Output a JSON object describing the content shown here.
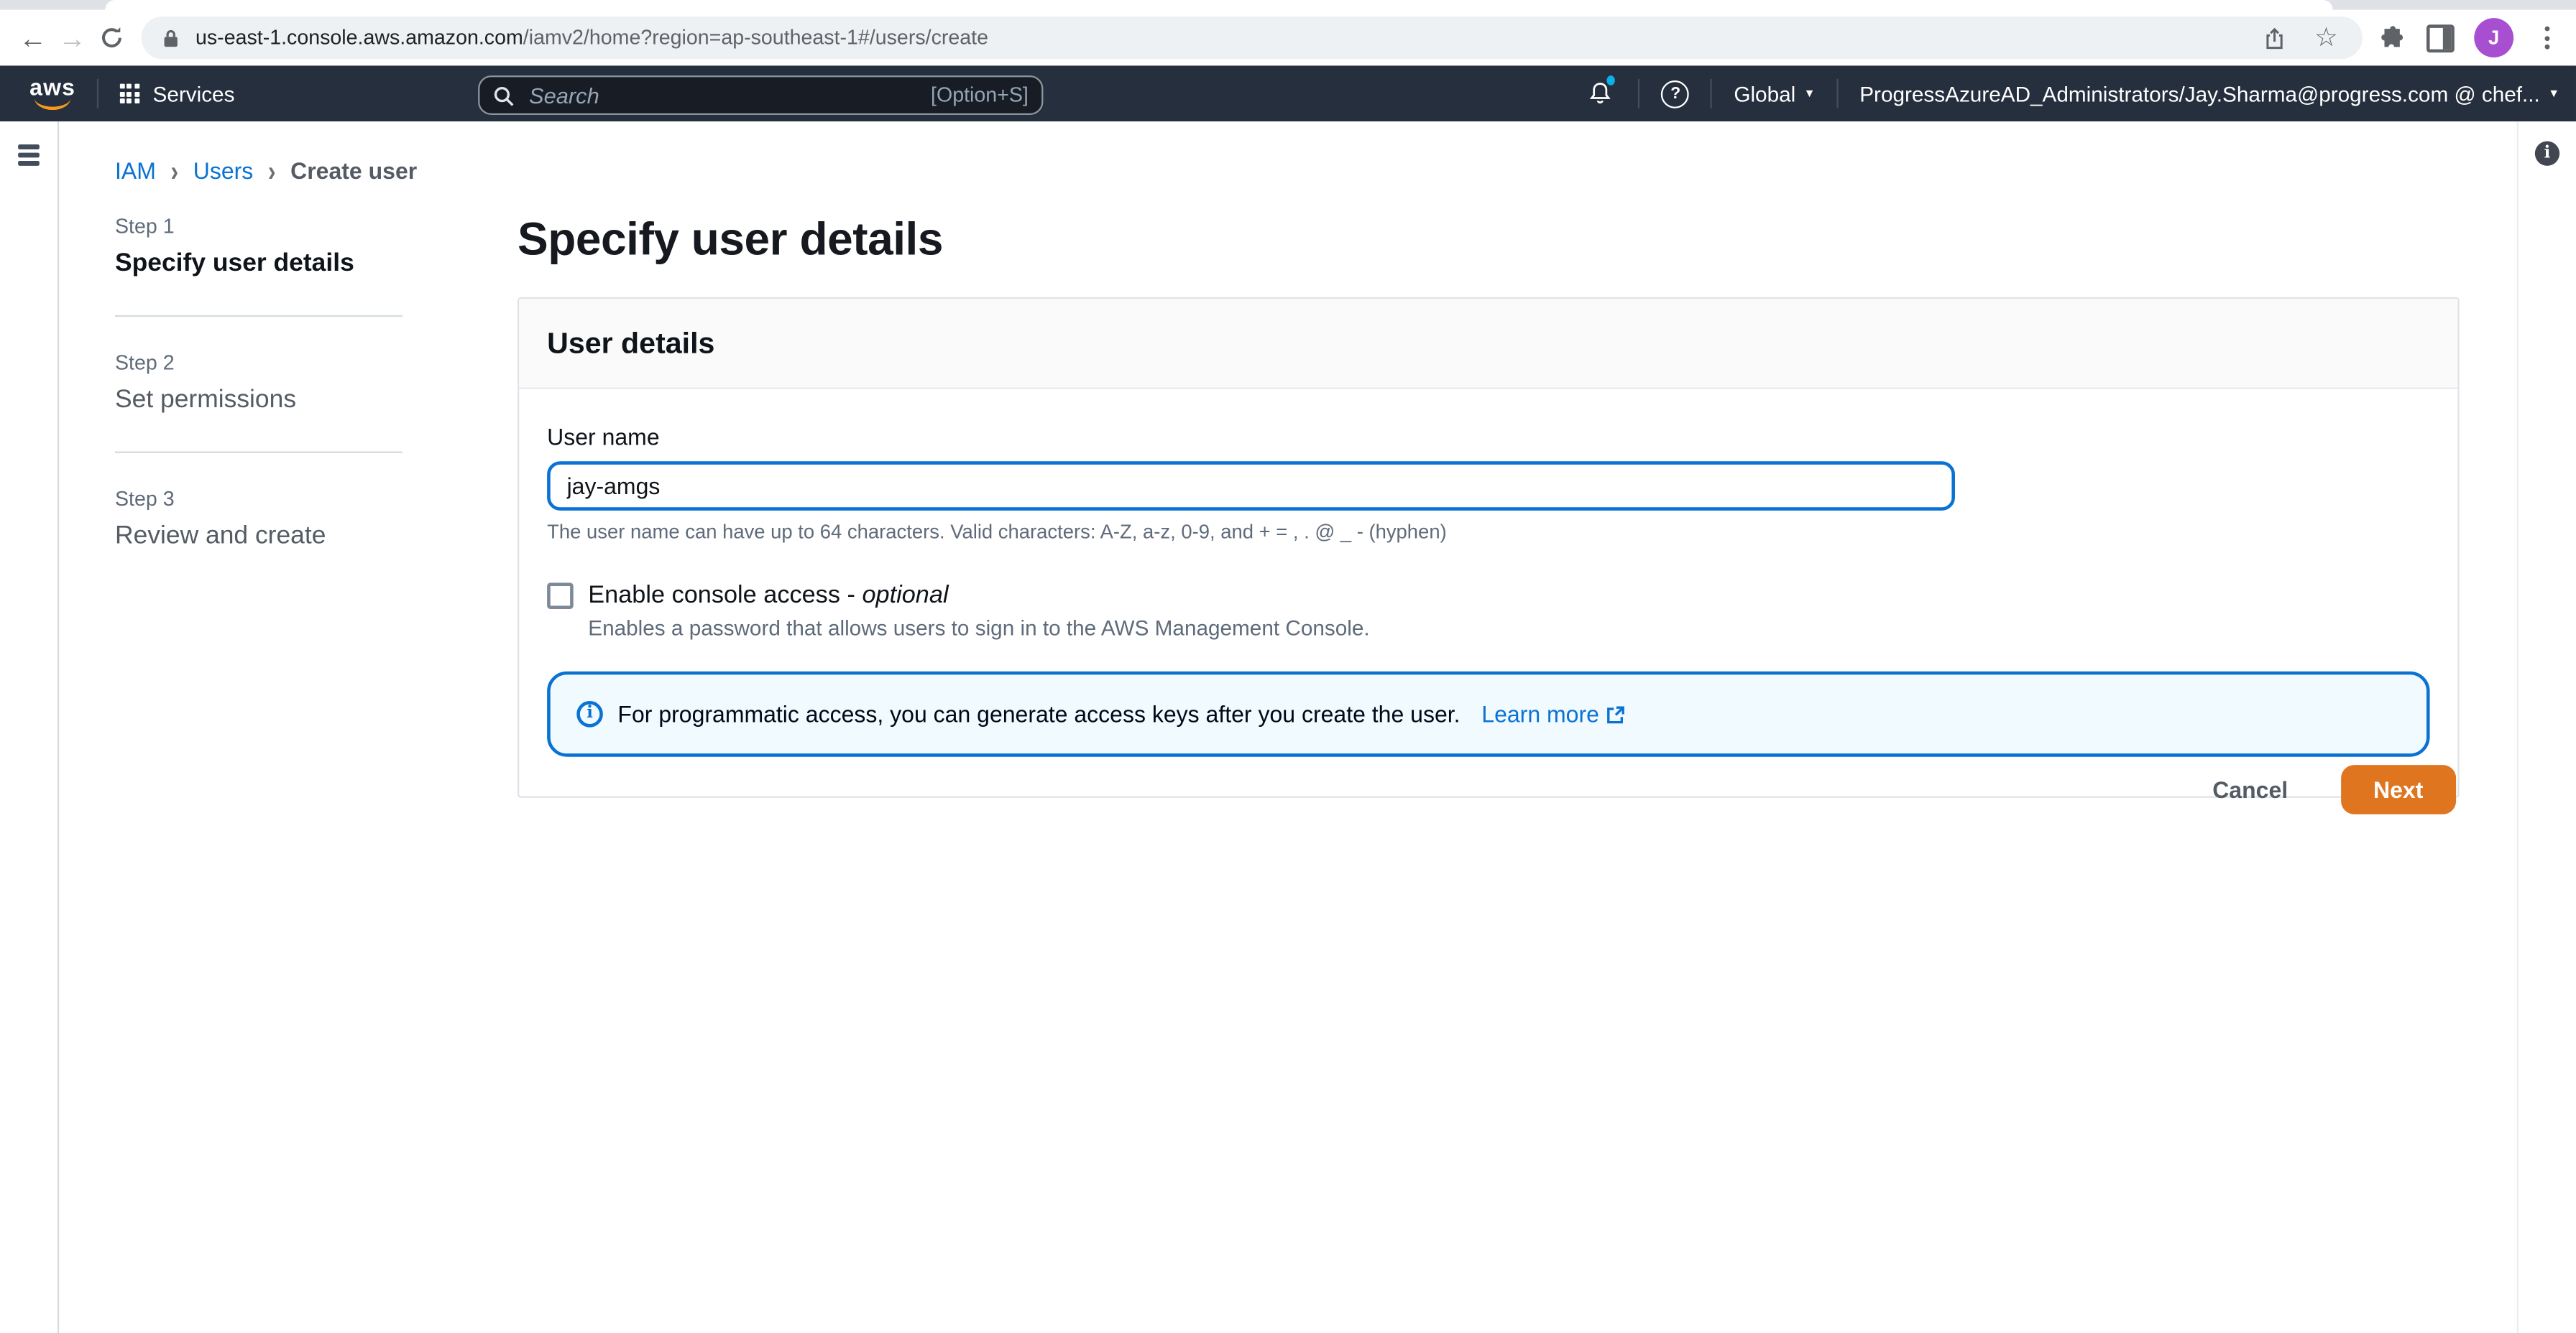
{
  "theme": {
    "nav_bg": "#252f3d",
    "accent_orange": "#e0751f",
    "link_blue": "#0972d3",
    "alert_bg": "#f1faff",
    "focus_border": "#0972d3",
    "avatar_purple": "#a84fd1",
    "notification_dot": "#0bb0e8",
    "aws_smile": "#f89820"
  },
  "browser": {
    "url_domain": "us-east-1.console.aws.amazon.com",
    "url_path": "/iamv2/home?region=ap-southeast-1#/users/create",
    "avatar_initial": "J"
  },
  "nav": {
    "logo": "aws",
    "services_label": "Services",
    "search_placeholder": "Search",
    "search_shortcut": "[Option+S]",
    "region_label": "Global",
    "account_label": "ProgressAzureAD_Administrators/Jay.Sharma@progress.com @ chef..."
  },
  "breadcrumb": {
    "items": [
      {
        "label": "IAM"
      },
      {
        "label": "Users"
      },
      {
        "label": "Create user"
      }
    ]
  },
  "steps": [
    {
      "step": "Step 1",
      "label": "Specify user details",
      "active": true
    },
    {
      "step": "Step 2",
      "label": "Set permissions",
      "active": false
    },
    {
      "step": "Step 3",
      "label": "Review and create",
      "active": false
    }
  ],
  "main": {
    "title": "Specify user details",
    "card": {
      "header": "User details",
      "username_label": "User name",
      "username_value": "jay-amgs",
      "username_help": "The user name can have up to 64 characters. Valid characters: A-Z, a-z, 0-9, and + = , . @ _ - (hyphen)",
      "console_access_label": "Enable console access - ",
      "console_access_optional": "optional",
      "console_access_desc": "Enables a password that allows users to sign in to the AWS Management Console.",
      "alert_text": "For programmatic access, you can generate access keys after you create the user.",
      "alert_link": "Learn more"
    },
    "actions": {
      "cancel": "Cancel",
      "next": "Next"
    }
  }
}
